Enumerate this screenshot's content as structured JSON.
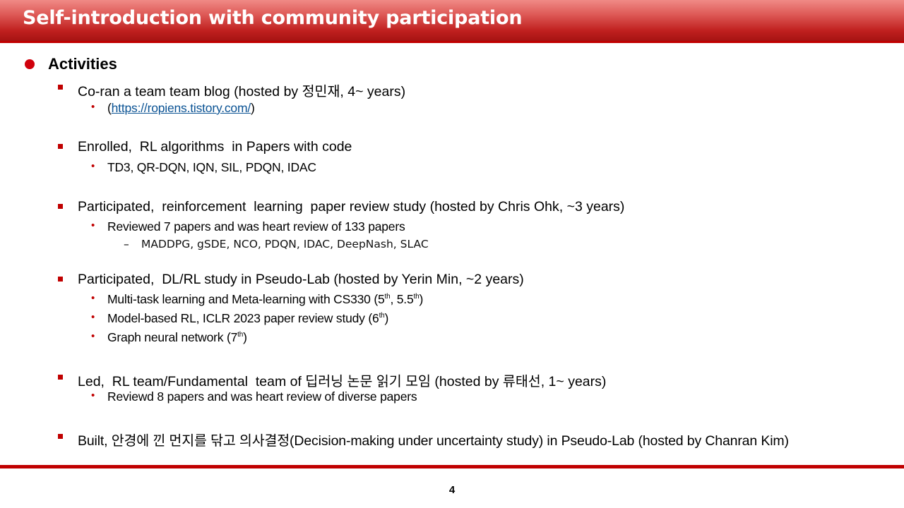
{
  "slide": {
    "title": "Self-introduction with community participation",
    "page_number": "4"
  },
  "content": {
    "section": "Activities",
    "items": [
      {
        "text": "Co-ran a team team blog (hosted by 정민재, 4~ years)",
        "subs": [
          {
            "pre": "(",
            "link": "https://ropiens.tistory.com/",
            "post": ")"
          }
        ]
      },
      {
        "text": "Enrolled,  RL algorithms  in Papers with code",
        "subs": [
          {
            "text": "TD3, QR-DQN, IQN, SIL, PDQN, IDAC"
          }
        ]
      },
      {
        "text": "Participated,  reinforcement  learning  paper review study (hosted by Chris Ohk, ~3 years)",
        "subs": [
          {
            "text": "Reviewed 7 papers and was heart review of 133 papers"
          }
        ],
        "subsubs": [
          {
            "text": "MADDPG, gSDE, NCO, PDQN, IDAC, DeepNash, SLAC"
          }
        ]
      },
      {
        "text": "Participated,  DL/RL study in Pseudo-Lab (hosted by Yerin Min, ~2 years)",
        "subs": [
          {
            "text": "Multi-task learning and Meta-learning with CS330 (5",
            "sup1": "th",
            "mid": ", 5.5",
            "sup2": "th",
            "post": ")"
          },
          {
            "text": "Model-based RL, ICLR 2023 paper review study (6",
            "sup1": "th",
            "post": ")"
          },
          {
            "text": "Graph neural network (7",
            "sup1": "th",
            "post": ")"
          }
        ]
      },
      {
        "text": "Led,  RL team/Fundamental  team of 딥러닝 논문 읽기 모임 (hosted by 류태선, 1~ years)",
        "subs": [
          {
            "text": "Reviewd 8 papers and was heart review of diverse papers"
          }
        ]
      },
      {
        "text": "Built, 안경에 낀 먼지를 닦고 의사결정(Decision-making under uncertainty study) in Pseudo-Lab (hosted by Chanran Kim)"
      }
    ]
  }
}
